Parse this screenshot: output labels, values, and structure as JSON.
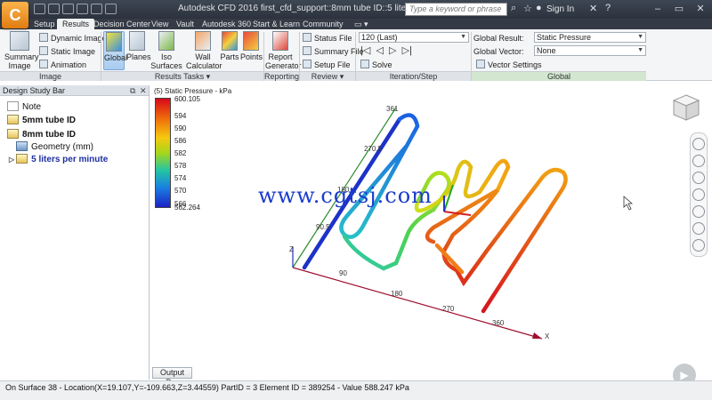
{
  "app_icon_letter": "C",
  "title": "Autodesk CFD 2016   first_cfd_support::8mm tube ID::5 liters per minute",
  "search": {
    "placeholder": "Type a keyword or phrase"
  },
  "signin": "Sign In",
  "tabs": [
    "Setup",
    "Results",
    "Decision Center",
    "View",
    "Vault",
    "Autodesk 360",
    "Start & Learn",
    "Community"
  ],
  "ribbon": {
    "image": {
      "summary_image": "Summary Image",
      "dynamic_image": "Dynamic Image",
      "static_image": "Static Image",
      "animation": "Animation",
      "group": "Image"
    },
    "results_tasks": {
      "global": "Global",
      "planes": "Planes",
      "iso_surfaces": "Iso Surfaces",
      "wall_calculator": "Wall Calculator",
      "parts": "Parts",
      "points": "Points",
      "group": "Results Tasks ▾"
    },
    "reporting": {
      "report_generator": "Report Generator",
      "group": "Reporting"
    },
    "review": {
      "status_file": "Status File",
      "summary_file": "Summary File",
      "setup_file": "Setup File",
      "group": "Review ▾"
    },
    "iteration": {
      "step_value": "120 (Last)",
      "solve": "Solve",
      "group": "Iteration/Step"
    },
    "global": {
      "global_result_label": "Global Result:",
      "global_result_value": "Static Pressure",
      "global_vector_label": "Global Vector:",
      "global_vector_value": "None",
      "vector_settings": "Vector Settings",
      "group": "Global"
    }
  },
  "left_panel": {
    "header": "Design Study Bar",
    "items": [
      {
        "label": "Note"
      },
      {
        "label": "5mm tube ID"
      },
      {
        "label": "8mm tube ID"
      },
      {
        "label": "Geometry (mm)"
      },
      {
        "label": "5 liters per minute"
      }
    ]
  },
  "legend": {
    "title": "(5) Static Pressure - kPa",
    "max": "600.105",
    "ticks": [
      "594",
      "590",
      "586",
      "582",
      "578",
      "574",
      "570",
      "566"
    ],
    "min": "562.264"
  },
  "axes": {
    "x_ticks": [
      "90",
      "180",
      "270",
      "360"
    ],
    "y_ticks": [
      "90.5",
      "180",
      "270.5",
      "361"
    ],
    "x_label": "X",
    "z_label": "Z"
  },
  "watermark": "www.cgtsj.com",
  "output_bar": "Output Bar",
  "status": "On Surface 38 - Location(X=19.107,Y=-109.663,Z=3.44559) PartID = 3 Element ID = 389254 - Value 588.247  kPa"
}
